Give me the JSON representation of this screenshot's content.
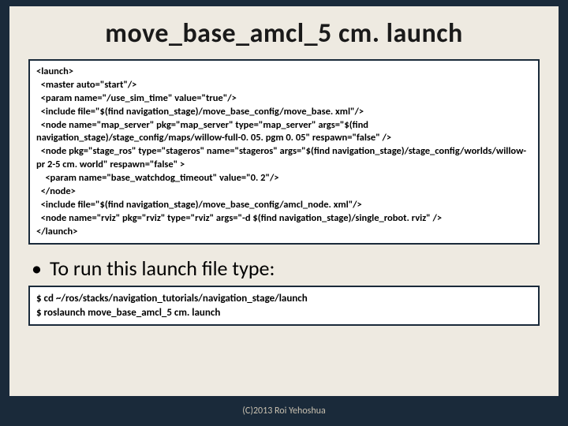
{
  "title": "move_base_amcl_5 cm. launch",
  "launch_code": "<launch>\n  <master auto=\"start\"/>\n  <param name=\"/use_sim_time\" value=\"true\"/>\n  <include file=\"$(find navigation_stage)/move_base_config/move_base. xml\"/>\n  <node name=\"map_server\" pkg=\"map_server\" type=\"map_server\" args=\"$(find navigation_stage)/stage_config/maps/willow-full-0. 05. pgm 0. 05\" respawn=\"false\" />\n  <node pkg=\"stage_ros\" type=\"stageros\" name=\"stageros\" args=\"$(find navigation_stage)/stage_config/worlds/willow-pr 2-5 cm. world\" respawn=\"false\" >\n    <param name=\"base_watchdog_timeout\" value=\"0. 2\"/>\n  </node>\n  <include file=\"$(find navigation_stage)/move_base_config/amcl_node. xml\"/>\n  <node name=\"rviz\" pkg=\"rviz\" type=\"rviz\" args=\"-d $(find navigation_stage)/single_robot. rviz\" />\n</launch>",
  "bullet_text": "To run this launch file type:",
  "run_code": "$ cd ~/ros/stacks/navigation_tutorials/navigation_stage/launch\n$ roslaunch move_base_amcl_5 cm. launch",
  "footer": "(C)2013 Roi Yehoshua"
}
